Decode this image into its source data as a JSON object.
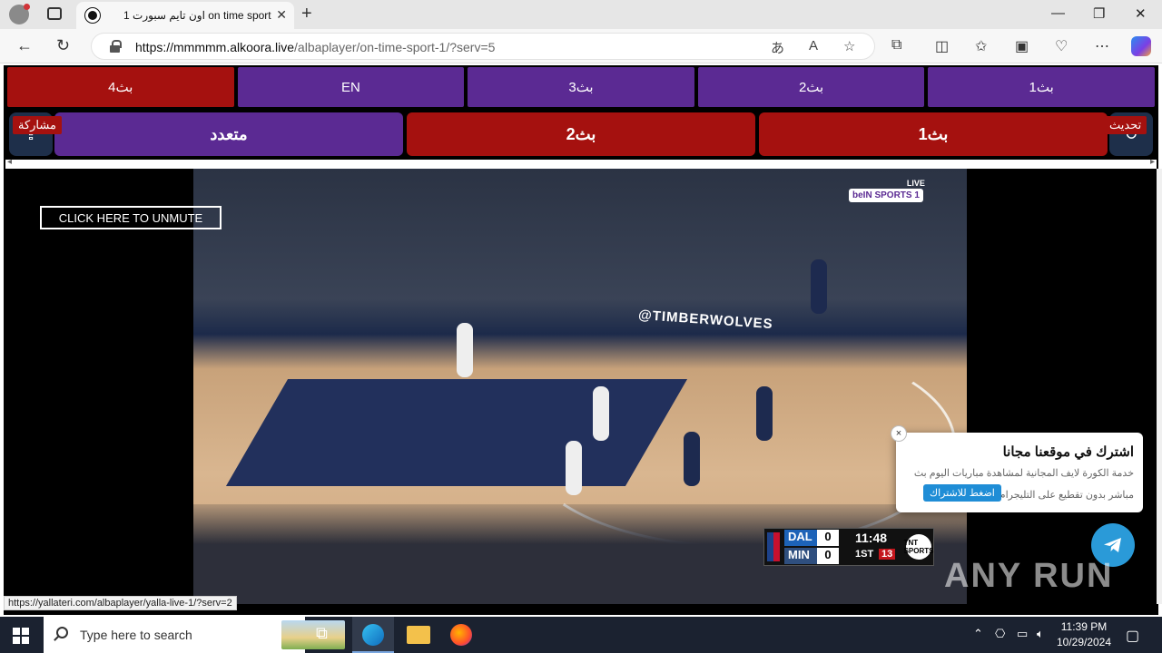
{
  "browser": {
    "tab_title": "اون تايم سبورت 1 on time sport",
    "url_host": "https://mmmmm.alkoora.live",
    "url_path": "/albaplayer/on-time-sport-1/?serv=5"
  },
  "player_page": {
    "servers_row1": [
      {
        "label": "بث4",
        "color": "red"
      },
      {
        "label": "EN",
        "color": "purple"
      },
      {
        "label": "بث3",
        "color": "purple"
      },
      {
        "label": "بث2",
        "color": "purple"
      },
      {
        "label": "بث1",
        "color": "purple"
      }
    ],
    "servers_row2": [
      {
        "label": "متعدد",
        "color": "purple"
      },
      {
        "label": "بث2",
        "color": "red"
      },
      {
        "label": "بث1",
        "color": "red"
      }
    ],
    "share_label": "مشاركة",
    "refresh_label": "تحديث",
    "unmute_label": "CLICK HERE TO UNMUTE",
    "broadcast": {
      "network_logo": "beIN SPORTS 1",
      "live_label": "LIVE",
      "sign_text": "@TIMBERWOLVES"
    },
    "scorebug": {
      "team1": "DAL",
      "score1": "0",
      "team2": "MIN",
      "score2": "0",
      "clock": "11:48",
      "quarter": "1ST",
      "shot_clock": "13",
      "network": "TNT SPORTS"
    },
    "popup": {
      "title": "اشترك في موقعنا مجانا",
      "line1": "خدمة الكورة لايف المجانية لمشاهدة مباريات اليوم بث",
      "line2": "مباشر بدون تقطيع على التليجرام",
      "button": "اضغط للاشتراك",
      "close": "×"
    },
    "status_url": "https://yallateri.com/albaplayer/yalla-live-1/?serv=2",
    "watermark": "ANY RUN"
  },
  "taskbar": {
    "search_placeholder": "Type here to search",
    "time": "11:39 PM",
    "date": "10/29/2024"
  },
  "colors": {
    "purple": "#5b2a93",
    "red": "#a5110f",
    "telegram": "#2a9ad8"
  }
}
